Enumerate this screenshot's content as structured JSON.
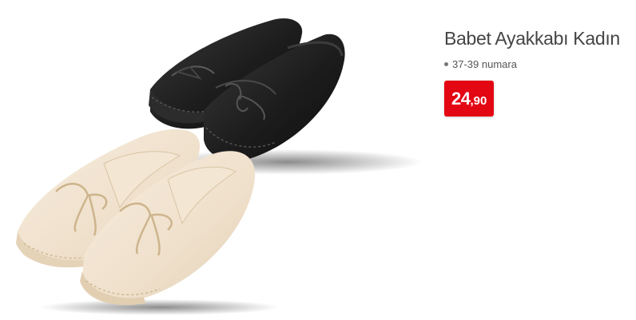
{
  "product": {
    "title": "Babet Ayakkabı Kadın",
    "features": [
      "37-39 numara"
    ],
    "price": {
      "integer": "24",
      "decimal": ",90"
    },
    "image": {
      "subject": "shoe-pair-icon"
    }
  },
  "colors": {
    "price_badge": "#e30613",
    "title_text": "#444444",
    "shoe_black": "#1c1c1c",
    "shoe_cream": "#efe0cb"
  }
}
